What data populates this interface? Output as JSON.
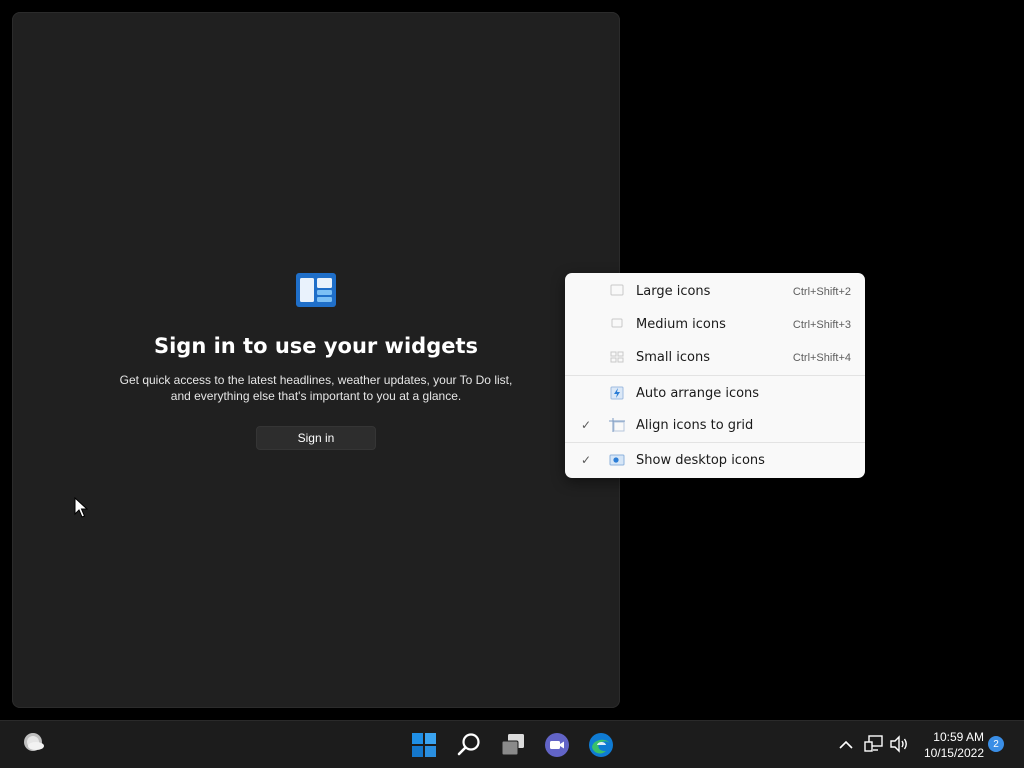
{
  "widgets": {
    "title": "Sign in to use your widgets",
    "description": "Get quick access to the latest headlines, weather updates, your To Do list, and everything else that's important to you at a glance.",
    "sign_in_label": "Sign in",
    "accent_color": "#2b7dd6"
  },
  "context_menu": {
    "items": [
      {
        "label": "Large icons",
        "shortcut": "Ctrl+Shift+2",
        "checked": false,
        "icon": "large-icons-icon"
      },
      {
        "label": "Medium icons",
        "shortcut": "Ctrl+Shift+3",
        "checked": false,
        "icon": "medium-icons-icon"
      },
      {
        "label": "Small icons",
        "shortcut": "Ctrl+Shift+4",
        "checked": false,
        "icon": "small-icons-icon"
      },
      {
        "label": "Auto arrange icons",
        "shortcut": "",
        "checked": false,
        "icon": "auto-arrange-icon"
      },
      {
        "label": "Align icons to grid",
        "shortcut": "",
        "checked": true,
        "icon": "align-grid-icon"
      },
      {
        "label": "Show desktop icons",
        "shortcut": "",
        "checked": true,
        "icon": "show-desktop-icon"
      }
    ],
    "check_glyph": "✓"
  },
  "taskbar": {
    "time": "10:59 AM",
    "date": "10/15/2022",
    "notification_count": "2",
    "icons": [
      "weather-icon",
      "start-icon",
      "search-icon",
      "task-view-icon",
      "teams-chat-icon",
      "edge-icon",
      "chevron-up-icon",
      "network-icon",
      "volume-icon"
    ],
    "accent_color": "#3a8ee6"
  }
}
